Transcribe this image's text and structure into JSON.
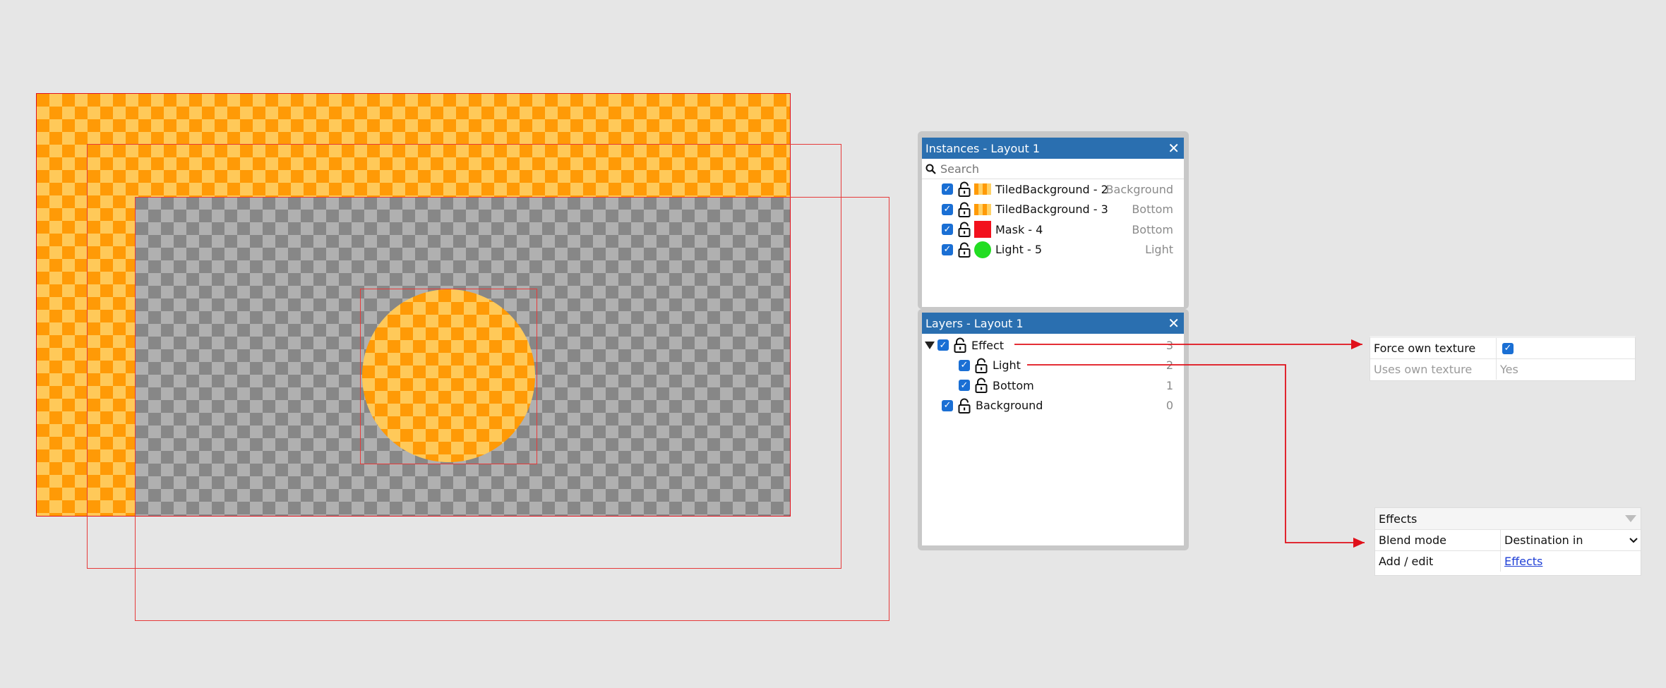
{
  "instances_panel": {
    "title": "Instances - Layout 1",
    "search_placeholder": "Search",
    "items": [
      {
        "name": "TiledBackground - 2",
        "layer": "Background",
        "thumb": "tiled-orange"
      },
      {
        "name": "TiledBackground - 3",
        "layer": "Bottom",
        "thumb": "tiled-orange"
      },
      {
        "name": "Mask - 4",
        "layer": "Bottom",
        "thumb": "red-square"
      },
      {
        "name": "Light - 5",
        "layer": "Light",
        "thumb": "green-circle"
      }
    ]
  },
  "layers_panel": {
    "title": "Layers - Layout 1",
    "items": [
      {
        "name": "Effect",
        "index": "3"
      },
      {
        "name": "Light",
        "index": "2"
      },
      {
        "name": "Bottom",
        "index": "1"
      },
      {
        "name": "Background",
        "index": "0"
      }
    ]
  },
  "texture_props": {
    "force_label": "Force own texture",
    "uses_label": "Uses own texture",
    "uses_value": "Yes"
  },
  "effects_props": {
    "section_title": "Effects",
    "blend_label": "Blend mode",
    "blend_value": "Destination in",
    "add_label": "Add / edit",
    "add_link": "Effects"
  },
  "colors": {
    "panel_header": "#2a6fb0",
    "checkbox": "#1a6fd4",
    "annotation_red": "#e0101a",
    "orange": "#ff9a06",
    "orange_light": "#ffc959"
  },
  "icons": {
    "close": "close-icon",
    "search": "search-icon",
    "lock": "lock-icon",
    "expand": "triangle-down-icon",
    "dropdown": "chevron-down-icon"
  }
}
